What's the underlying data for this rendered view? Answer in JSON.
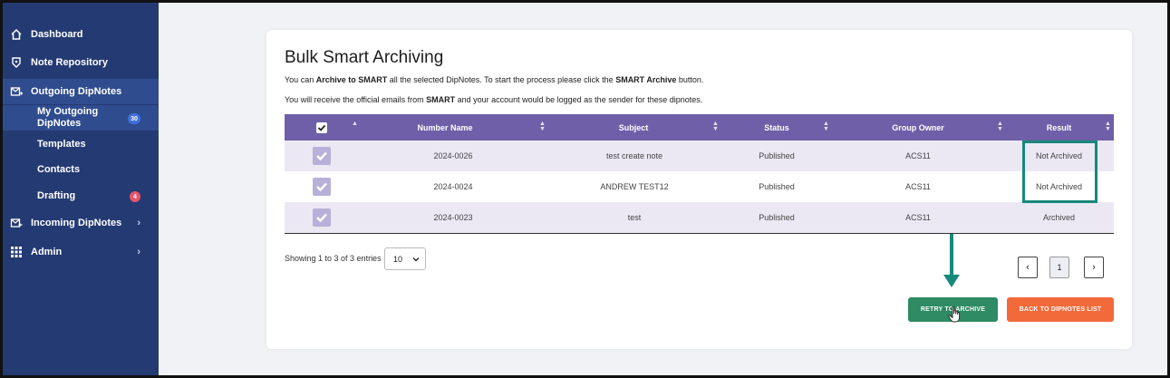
{
  "sidebar": {
    "items": [
      {
        "label": "Dashboard",
        "icon": "home-icon"
      },
      {
        "label": "Note Repository",
        "icon": "shield-icon"
      },
      {
        "label": "Outgoing DipNotes",
        "icon": "outgoing-mail-icon"
      },
      {
        "label": "Incoming DipNotes",
        "icon": "incoming-mail-icon"
      },
      {
        "label": "Admin",
        "icon": "grid-icon"
      }
    ],
    "subitems": {
      "my_outgoing_line1": "My Outgoing",
      "my_outgoing_line2": "DipNotes",
      "my_outgoing_badge": "30",
      "templates": "Templates",
      "contacts": "Contacts",
      "drafting": "Drafting",
      "drafting_badge": "4"
    },
    "colors": {
      "background": "#243a73",
      "active": "#2f4c8f",
      "badge_blue": "#3f6fe0",
      "badge_red": "#e8556b"
    }
  },
  "page": {
    "title": "Bulk Smart Archiving",
    "info1": {
      "part1": "You can ",
      "bold1": "Archive to SMART",
      "part2": " all the selected DipNotes. To start the process please click the ",
      "bold2": "SMART Archive",
      "part3": " button."
    },
    "info2": {
      "part1": "You will receive the official emails from ",
      "bold1": "SMART",
      "part2": " and your account would be logged as the sender for these dipnotes."
    }
  },
  "table": {
    "columns": [
      "Number Name",
      "Subject",
      "Status",
      "Group Owner",
      "Result"
    ],
    "rows": [
      {
        "number": "2024-0026",
        "subject": "test create note",
        "status": "Published",
        "group": "ACS11",
        "result": "Not Archived"
      },
      {
        "number": "2024-0024",
        "subject": "ANDREW TEST12",
        "status": "Published",
        "group": "ACS11",
        "result": "Not Archived"
      },
      {
        "number": "2024-0023",
        "subject": "test",
        "status": "Published",
        "group": "ACS11",
        "result": "Archived"
      }
    ],
    "header_color": "#6f5fa8"
  },
  "footer": {
    "showing": "Showing 1 to 3 of 3 entries",
    "page_size": "10",
    "prev": "‹",
    "page": "1",
    "next": "›"
  },
  "buttons": {
    "retry": "RETRY TO ARCHIVE",
    "back": "BACK TO DIPNOTES LIST"
  },
  "annotation_color": "#17887a"
}
